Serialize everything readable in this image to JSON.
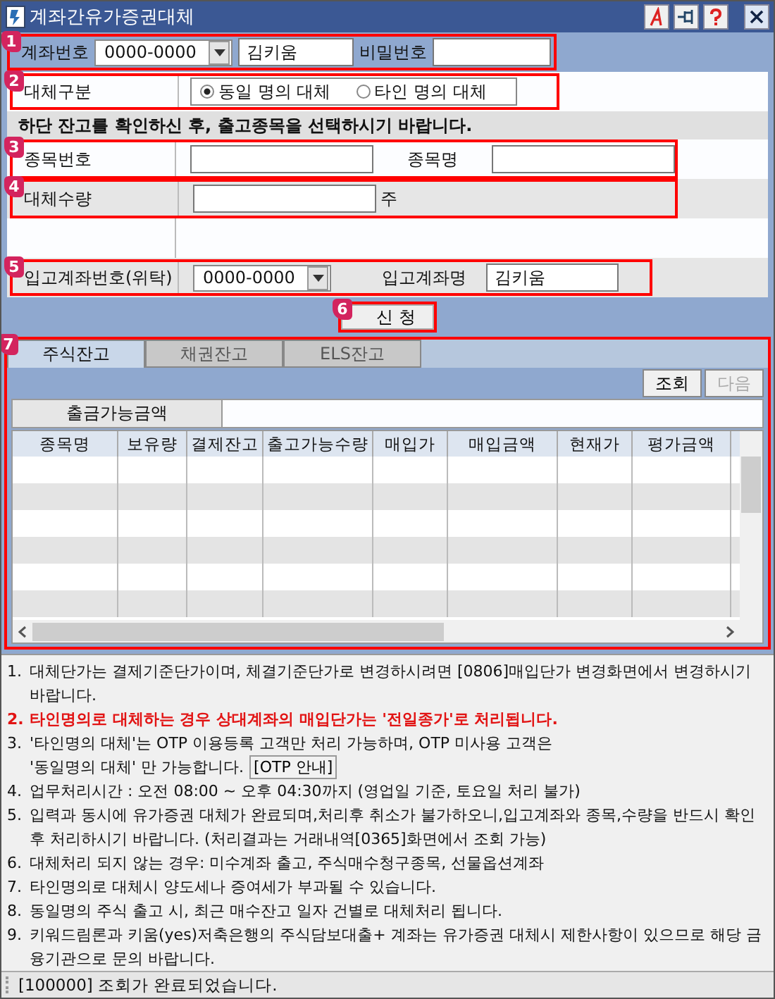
{
  "window": {
    "title": "계좌간유가증권대체"
  },
  "account": {
    "step": "1",
    "label": "계좌번호",
    "account_no": "0000-0000",
    "name": "김키움",
    "password_label": "비밀번호"
  },
  "transfer_type": {
    "step": "2",
    "label": "대체구분",
    "options": [
      {
        "label": "동일 명의 대체",
        "selected": true
      },
      {
        "label": "타인 명의 대체",
        "selected": false
      }
    ]
  },
  "info": "하단 잔고를 확인하신 후, 출고종목을 선택하시기 바랍니다.",
  "stock": {
    "step": "3",
    "code_label": "종목번호",
    "name_label": "종목명"
  },
  "quantity": {
    "step": "4",
    "label": "대체수량",
    "unit": "주"
  },
  "target": {
    "step": "5",
    "label": "입고계좌번호(위탁)",
    "account_no": "0000-0000",
    "name_label": "입고계좌명",
    "name": "김키움"
  },
  "submit": {
    "step": "6",
    "label": "신 청"
  },
  "balance": {
    "step": "7",
    "tabs": [
      {
        "label": "주식잔고",
        "selected": true
      },
      {
        "label": "채권잔고",
        "selected": false
      },
      {
        "label": "ELS잔고",
        "selected": false
      }
    ],
    "buttons": [
      {
        "label": "조회",
        "disabled": false
      },
      {
        "label": "다음",
        "disabled": true
      }
    ],
    "withdraw_label": "출금가능금액",
    "columns": [
      "종목명",
      "보유량",
      "결제잔고",
      "출고가능수량",
      "매입가",
      "매입금액",
      "현재가",
      "평가금액"
    ]
  },
  "notes": [
    {
      "kind": "normal",
      "number": "1.",
      "text": "대체단가는 결제기준단가이며, 체결기준단가로 변경하시려면 [0806]매입단가 변경화면에서 변경하시기 바랍니다."
    },
    {
      "kind": "warning",
      "number": "2.",
      "text": "타인명의로 대체하는 경우 상대계좌의 매입단가는 '전일종가'로 처리됩니다."
    },
    {
      "kind": "normal",
      "number": "3.",
      "text": "'타인명의 대체'는 OTP 이용등록 고객만 처리 가능하며, OTP 미사용 고객은",
      "continuation": "'동일명의 대체' 만 가능합니다.",
      "button": "[OTP 안내]"
    },
    {
      "kind": "normal",
      "number": "4.",
      "text": "업무처리시간 : 오전 08:00 ~ 오후 04:30까지 (영업일 기준, 토요일 처리 불가)"
    },
    {
      "kind": "normal",
      "number": "5.",
      "text": "입력과 동시에 유가증권 대체가 완료되며,처리후 취소가 불가하오니,입고계좌와 종목,수량을 반드시 확인 후 처리하시기 바랍니다. (처리결과는 거래내역[0365]화면에서 조회 가능)"
    },
    {
      "kind": "normal",
      "number": "6.",
      "text": "대체처리 되지 않는 경우: 미수계좌 출고, 주식매수청구종목, 선물옵션계좌"
    },
    {
      "kind": "normal",
      "number": "7.",
      "text": "타인명의로 대체시 양도세나 증여세가 부과될 수 있습니다."
    },
    {
      "kind": "normal",
      "number": "8.",
      "text": "동일명의 주식 출고 시, 최근 매수잔고 일자 건별로 대체처리 됩니다."
    },
    {
      "kind": "normal",
      "number": "9.",
      "text": "키워드림론과 키움(yes)저축은행의 주식담보대출+ 계좌는 유가증권 대체시 제한사항이 있으므로 해당 금융기관으로 문의 바랍니다."
    }
  ],
  "status_bar": "[100000] 조회가 완료되었습니다."
}
